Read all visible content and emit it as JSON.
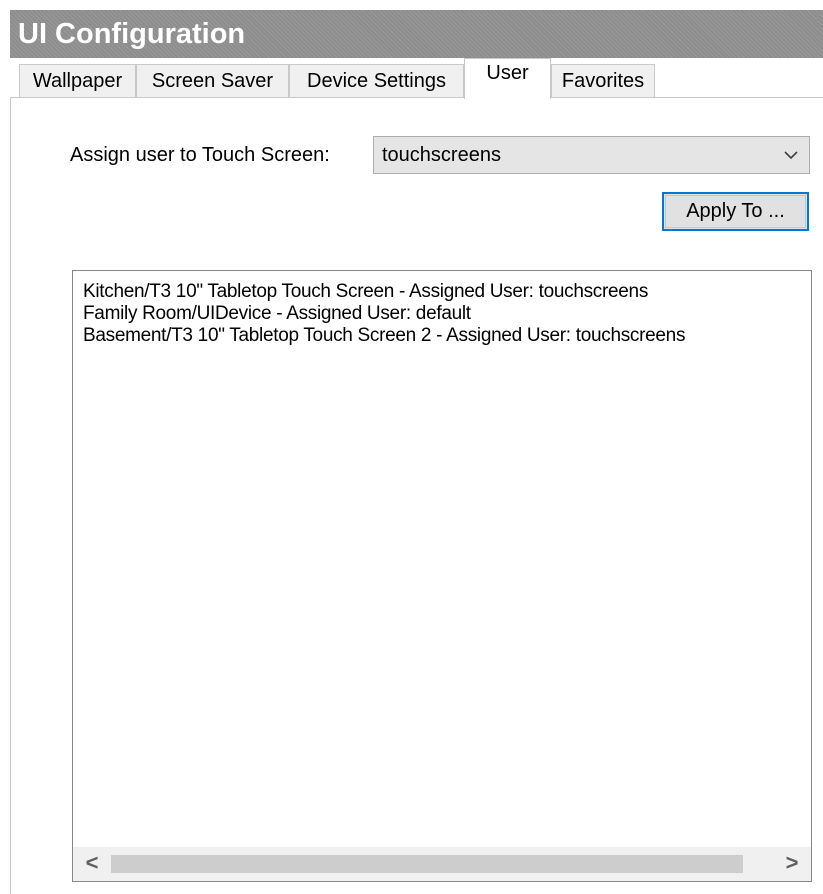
{
  "window": {
    "title": "UI Configuration"
  },
  "tabs": [
    {
      "label": "Wallpaper",
      "active": false
    },
    {
      "label": "Screen Saver",
      "active": false
    },
    {
      "label": "Device Settings",
      "active": false
    },
    {
      "label": "User",
      "active": true
    },
    {
      "label": "Favorites",
      "active": false
    }
  ],
  "assign": {
    "label": "Assign user to Touch Screen:",
    "selected_user": "touchscreens",
    "dropdown_icon": "chevron-down-icon"
  },
  "apply_button": {
    "label": "Apply To ..."
  },
  "device_list": {
    "items": [
      "Kitchen/T3 10\" Tabletop Touch Screen  - Assigned User: touchscreens",
      "Family Room/UIDevice  - Assigned User: default",
      "Basement/T3 10\" Tabletop Touch Screen 2  - Assigned User: touchscreens"
    ]
  },
  "scrollbar": {
    "left_icon": "chevron-left-icon",
    "right_icon": "chevron-right-icon",
    "left_glyph": "<",
    "right_glyph": ">"
  },
  "colors": {
    "title_bar": "#8d8d8d",
    "focus_border": "#0078d7",
    "combo_bg": "#e5e5e5"
  }
}
